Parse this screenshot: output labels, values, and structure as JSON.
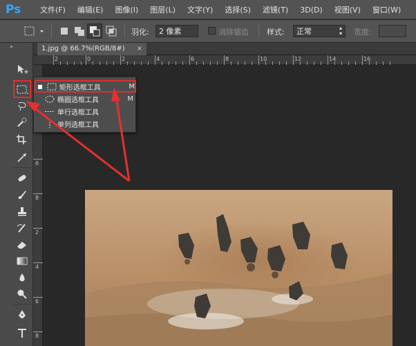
{
  "app": {
    "logo": "Ps"
  },
  "menu": [
    "文件(F)",
    "编辑(E)",
    "图像(I)",
    "图层(L)",
    "文字(Y)",
    "选择(S)",
    "滤镜(T)",
    "3D(D)",
    "视图(V)",
    "窗口(W)"
  ],
  "options": {
    "feather_label": "羽化:",
    "feather_value": "2 像素",
    "antialias_label": "消除锯齿",
    "style_label": "样式:",
    "style_value": "正常",
    "width_label": "宽度:"
  },
  "document": {
    "tab_title": "1.jpg @ 66.7%(RGB/8#)",
    "close": "×"
  },
  "ruler": {
    "h_ticks": [
      "2",
      "0",
      "2",
      "4",
      "6",
      "8",
      "10",
      "12",
      "14",
      "16"
    ],
    "v_ticks": [
      "2",
      "4",
      "6",
      "8",
      "2",
      "4",
      "6",
      "8"
    ]
  },
  "flyout": {
    "items": [
      {
        "label": "矩形选框工具",
        "key": "M",
        "active": true,
        "icon": "rect-marquee-icon"
      },
      {
        "label": "椭圆选框工具",
        "key": "M",
        "active": false,
        "icon": "ellipse-marquee-icon"
      },
      {
        "label": "单行选框工具",
        "key": "",
        "active": false,
        "icon": "single-row-marquee-icon"
      },
      {
        "label": "单列选框工具",
        "key": "",
        "active": false,
        "icon": "single-column-marquee-icon"
      }
    ]
  },
  "colors": {
    "highlight": "#e22d2d",
    "ps_blue": "#31a8ff",
    "panel": "#535353",
    "workspace": "#282828"
  }
}
